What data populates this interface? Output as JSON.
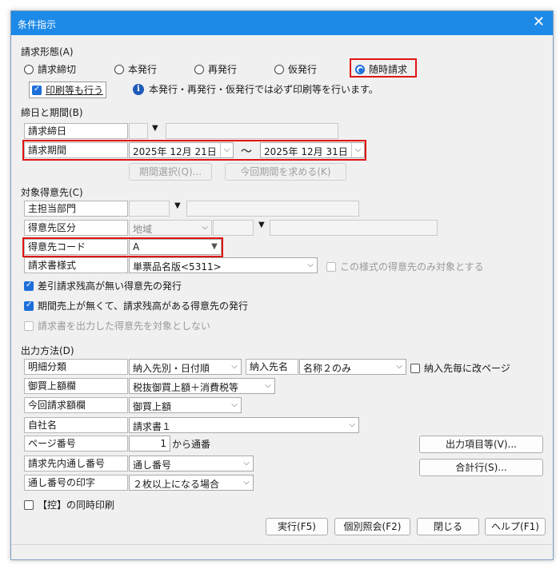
{
  "window": {
    "title": "条件指示",
    "close": "✕"
  },
  "billing_type": {
    "heading": "請求形態(A)",
    "options": [
      "請求締切",
      "本発行",
      "再発行",
      "仮発行",
      "随時請求"
    ],
    "selected": 4,
    "print_check": "印刷等も行う",
    "info_text": "本発行・再発行・仮発行では必ず印刷等を行います。"
  },
  "cutoff": {
    "heading": "締日と期間(B)",
    "closing_label": "請求締日",
    "period_label": "請求期間",
    "date_from": "2025年 12月 21日",
    "tilde": "〜",
    "date_to": "2025年 12月 31日",
    "btn_period_select": "期間選択(Q)...",
    "btn_next_period": "今回期間を求める(K)"
  },
  "customers": {
    "heading": "対象得意先(C)",
    "dept_label": "主担当部門",
    "class_label": "得意先区分",
    "class_value": "地域",
    "code_label": "得意先コード",
    "code_value": "A",
    "format_label": "請求書様式",
    "format_value": "単票品名版<5311>",
    "format_only_check": "この様式の得意先のみ対象とする",
    "check1": "差引請求残高が無い得意先の発行",
    "check2": "期間売上が無くて、請求残高がある得意先の発行",
    "check3": "請求書を出力した得意先を対象としない"
  },
  "output": {
    "heading": "出力方法(D)",
    "detail_label": "明細分類",
    "detail_value": "納入先別・日付順",
    "delivery_label": "納入先名",
    "delivery_value": "名称２のみ",
    "delivery_page_check": "納入先毎に改ページ",
    "purchase_label": "御買上額欄",
    "purchase_value": "税抜御買上額＋消費税等",
    "current_label": "今回請求額欄",
    "current_value": "御買上額",
    "company_label": "自社名",
    "company_value": "請求書１",
    "page_label": "ページ番号",
    "page_value": "1",
    "page_suffix": "から通番",
    "serial_label": "請求先内通し番号",
    "serial_value": "通し番号",
    "serial_print_label": "通し番号の印字",
    "serial_print_value": "２枚以上になる場合",
    "copy_check": "【控】の同時印刷",
    "btn_output_items": "出力項目等(V)...",
    "btn_total_line": "合計行(S)..."
  },
  "footer": {
    "execute": "実行(F5)",
    "individual": "個別照会(F2)",
    "close": "閉じる",
    "help": "ヘルプ(F1)"
  }
}
